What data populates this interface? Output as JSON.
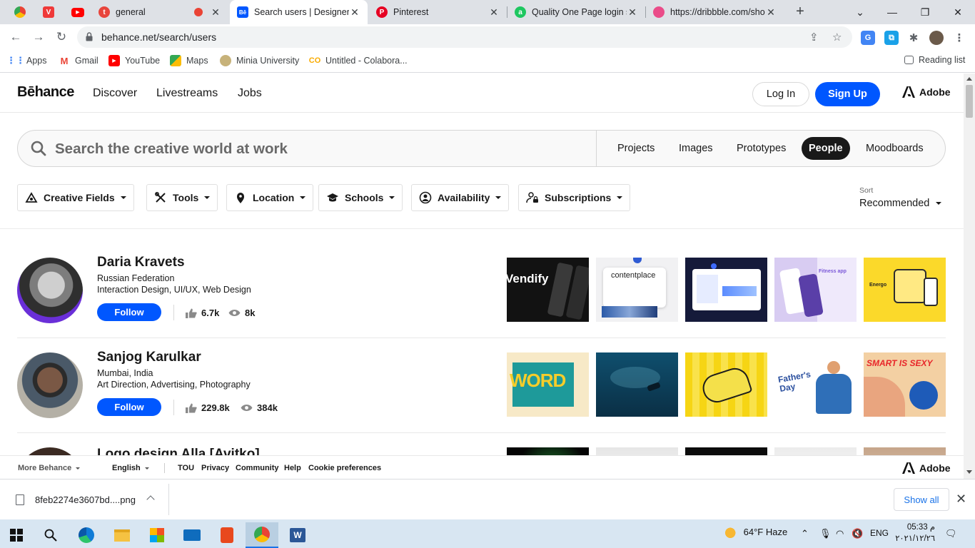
{
  "browser": {
    "tabs": [
      {
        "label": "",
        "icon": "chrome-icon"
      },
      {
        "label": "",
        "icon": "vivaldi-icon"
      },
      {
        "label": "",
        "icon": "youtube-icon"
      },
      {
        "label": "general",
        "icon": "app-icon"
      },
      {
        "label": "Search users | Designers",
        "icon": "behance-icon"
      },
      {
        "label": "Pinterest",
        "icon": "pinterest-icon"
      },
      {
        "label": "Quality One Page login s",
        "icon": "site-icon"
      },
      {
        "label": "https://dribbble.com/sho",
        "icon": "dribbble-icon"
      }
    ],
    "url": "behance.net/search/users",
    "bookmarks": [
      "Apps",
      "Gmail",
      "YouTube",
      "Maps",
      "Minia University",
      "Untitled - Colabora...",
      "Reading list"
    ]
  },
  "header": {
    "logo": "Bēhance",
    "nav": [
      "Discover",
      "Livestreams",
      "Jobs"
    ],
    "login": "Log In",
    "signup": "Sign Up",
    "adobe": "Adobe"
  },
  "search": {
    "placeholder": "Search the creative world at work",
    "types": [
      "Projects",
      "Images",
      "Prototypes",
      "People",
      "Moodboards"
    ],
    "active_type": "People"
  },
  "filters": [
    "Creative Fields",
    "Tools",
    "Location",
    "Schools",
    "Availability",
    "Subscriptions"
  ],
  "sort": {
    "label": "Sort",
    "value": "Recommended"
  },
  "users": [
    {
      "name": "Daria Kravets",
      "location": "Russian Federation",
      "fields": "Interaction Design, UI/UX, Web Design",
      "follow": "Follow",
      "appreciations": "6.7k",
      "views": "8k",
      "thumbs": [
        {
          "text": "Vendify"
        },
        {
          "text": "contentplace"
        },
        {
          "text": ""
        },
        {
          "text": "Fitness app"
        },
        {
          "text": "Energo"
        }
      ]
    },
    {
      "name": "Sanjog Karulkar",
      "location": "Mumbai, India",
      "fields": "Art Direction, Advertising, Photography",
      "follow": "Follow",
      "appreciations": "229.8k",
      "views": "384k",
      "thumbs": [
        {
          "text": "WORD"
        },
        {
          "text": ""
        },
        {
          "text": ""
        },
        {
          "text": "Father's Day"
        },
        {
          "text": "SMART IS SEXY"
        }
      ]
    },
    {
      "name": "Logo design Alla [Avitko]"
    }
  ],
  "footer": {
    "items": [
      "More Behance",
      "English",
      "TOU",
      "Privacy",
      "Community",
      "Help",
      "Cookie preferences"
    ],
    "adobe": "Adobe"
  },
  "download": {
    "filename": "8feb2274e3607bd....png",
    "show_all": "Show all"
  },
  "taskbar": {
    "weather": "64°F  Haze",
    "lang": "ENG",
    "time": "05:33 م",
    "date": "٢٠٢١/١٢/٢٦"
  },
  "colors": {
    "accent": "#0057ff",
    "chrome_bg": "#dee1e6",
    "taskbar_bg": "#d8e6f2"
  }
}
